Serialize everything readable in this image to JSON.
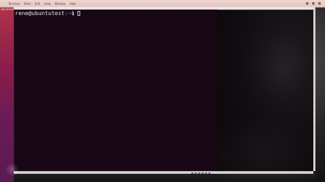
{
  "menubar": {
    "app_name": "Terminal",
    "items": [
      "Shell",
      "Edit",
      "View",
      "Window",
      "Help"
    ]
  },
  "vm_window": {
    "title": "",
    "left_label": "ubuntutest"
  },
  "terminal": {
    "prompt_user_host": "rene@ubuntutest",
    "prompt_path": ":~",
    "prompt_symbol": "$"
  },
  "colors": {
    "terminal_bg": "#1a0716",
    "prompt_user": "#e6e6e6",
    "prompt_path": "#6a9ee8",
    "menubar": "#efd5d0",
    "ubuntu_purple": "#8a1e4a"
  }
}
